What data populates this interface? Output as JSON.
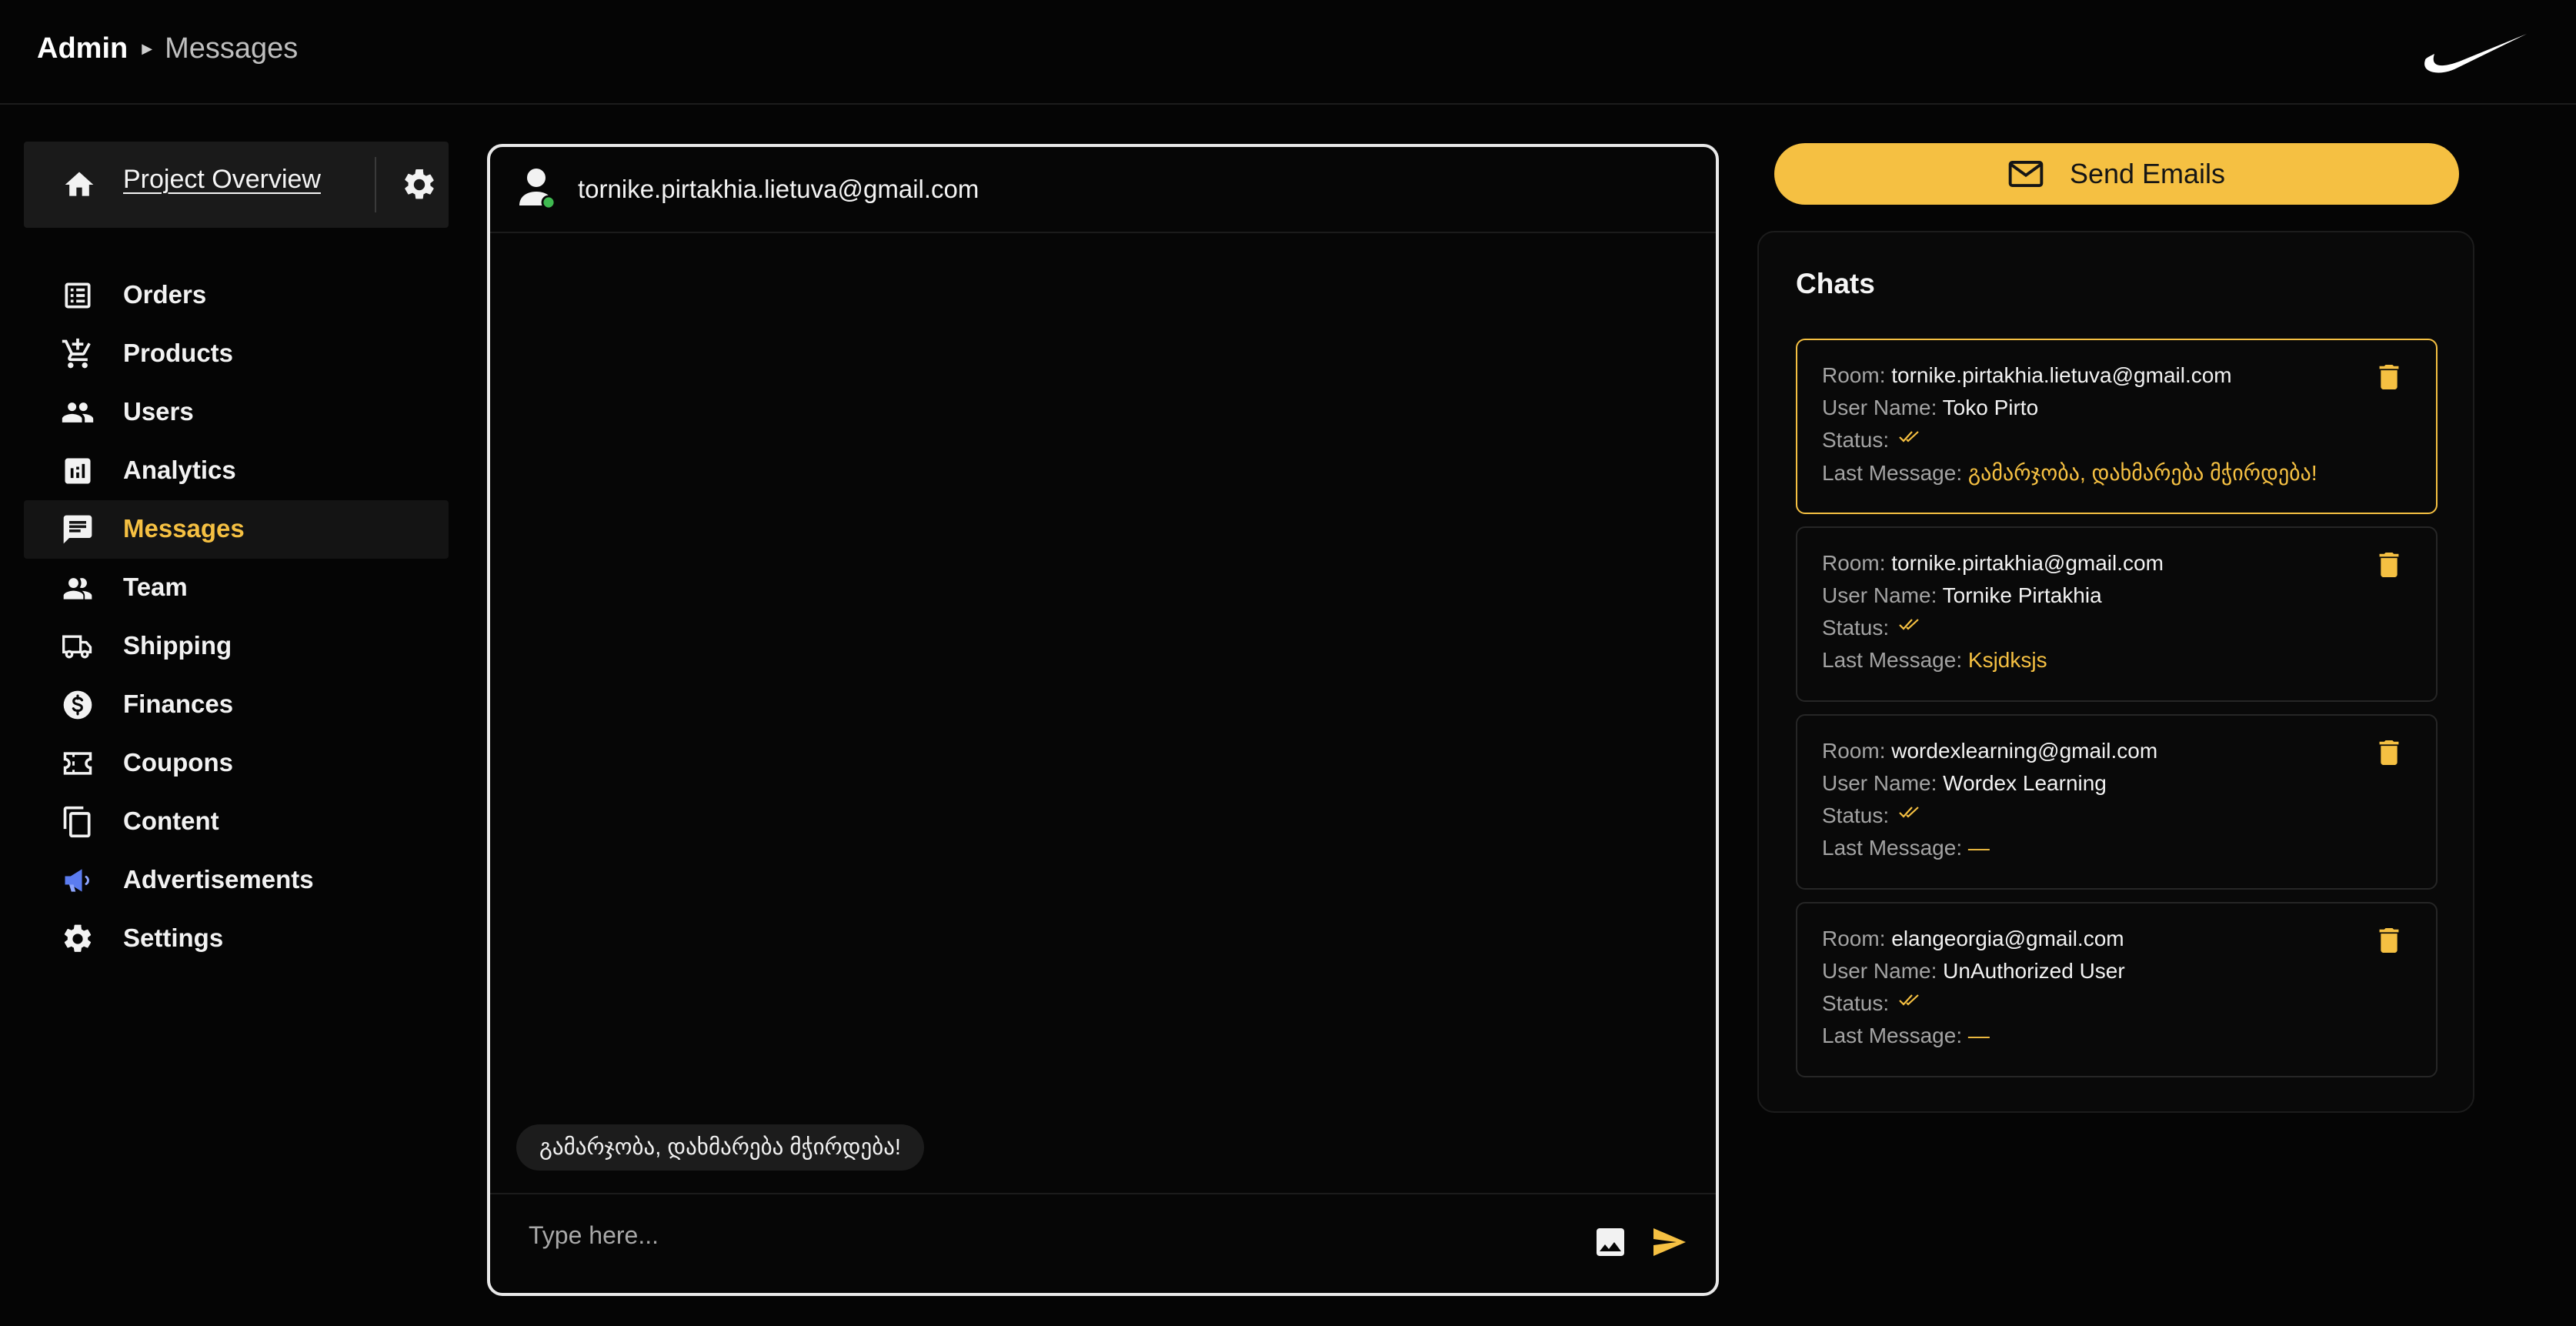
{
  "header": {
    "breadcrumb_root": "Admin",
    "breadcrumb_current": "Messages",
    "logo": "nike-swoosh-logo"
  },
  "sidebar": {
    "overview_label": "Project Overview",
    "items": [
      {
        "label": "Orders",
        "icon": "list-icon"
      },
      {
        "label": "Products",
        "icon": "cart-icon"
      },
      {
        "label": "Users",
        "icon": "users-icon"
      },
      {
        "label": "Analytics",
        "icon": "analytics-icon"
      },
      {
        "label": "Messages",
        "icon": "message-icon",
        "active": true
      },
      {
        "label": "Team",
        "icon": "team-icon"
      },
      {
        "label": "Shipping",
        "icon": "truck-icon"
      },
      {
        "label": "Finances",
        "icon": "dollar-icon"
      },
      {
        "label": "Coupons",
        "icon": "ticket-icon"
      },
      {
        "label": "Content",
        "icon": "copy-icon"
      },
      {
        "label": "Advertisements",
        "icon": "megaphone-icon"
      },
      {
        "label": "Settings",
        "icon": "gear-icon"
      }
    ]
  },
  "chat": {
    "email": "tornike.pirtakhia.lietuva@gmail.com",
    "messages": [
      "გამარჯობა, დახმარება მჭირდება!"
    ],
    "input_placeholder": "Type here..."
  },
  "actions": {
    "send_emails_label": "Send Emails"
  },
  "chats": {
    "title": "Chats",
    "labels": {
      "room": "Room:",
      "user_name": "User Name:",
      "status": "Status:",
      "last_message": "Last Message:"
    },
    "items": [
      {
        "room": "tornike.pirtakhia.lietuva@gmail.com",
        "user_name": "Toko Pirto",
        "last_message": "გამარჯობა, დახმარება მჭირდება!",
        "selected": true
      },
      {
        "room": "tornike.pirtakhia@gmail.com",
        "user_name": "Tornike Pirtakhia",
        "last_message": "Ksjdksjs"
      },
      {
        "room": "wordexlearning@gmail.com",
        "user_name": "Wordex Learning",
        "last_message": "—"
      },
      {
        "room": "elangeorgia@gmail.com",
        "user_name": "UnAuthorized User",
        "last_message": "—"
      }
    ]
  },
  "colors": {
    "accent": "#f5c042",
    "background": "#050505",
    "online": "#3fb950"
  }
}
